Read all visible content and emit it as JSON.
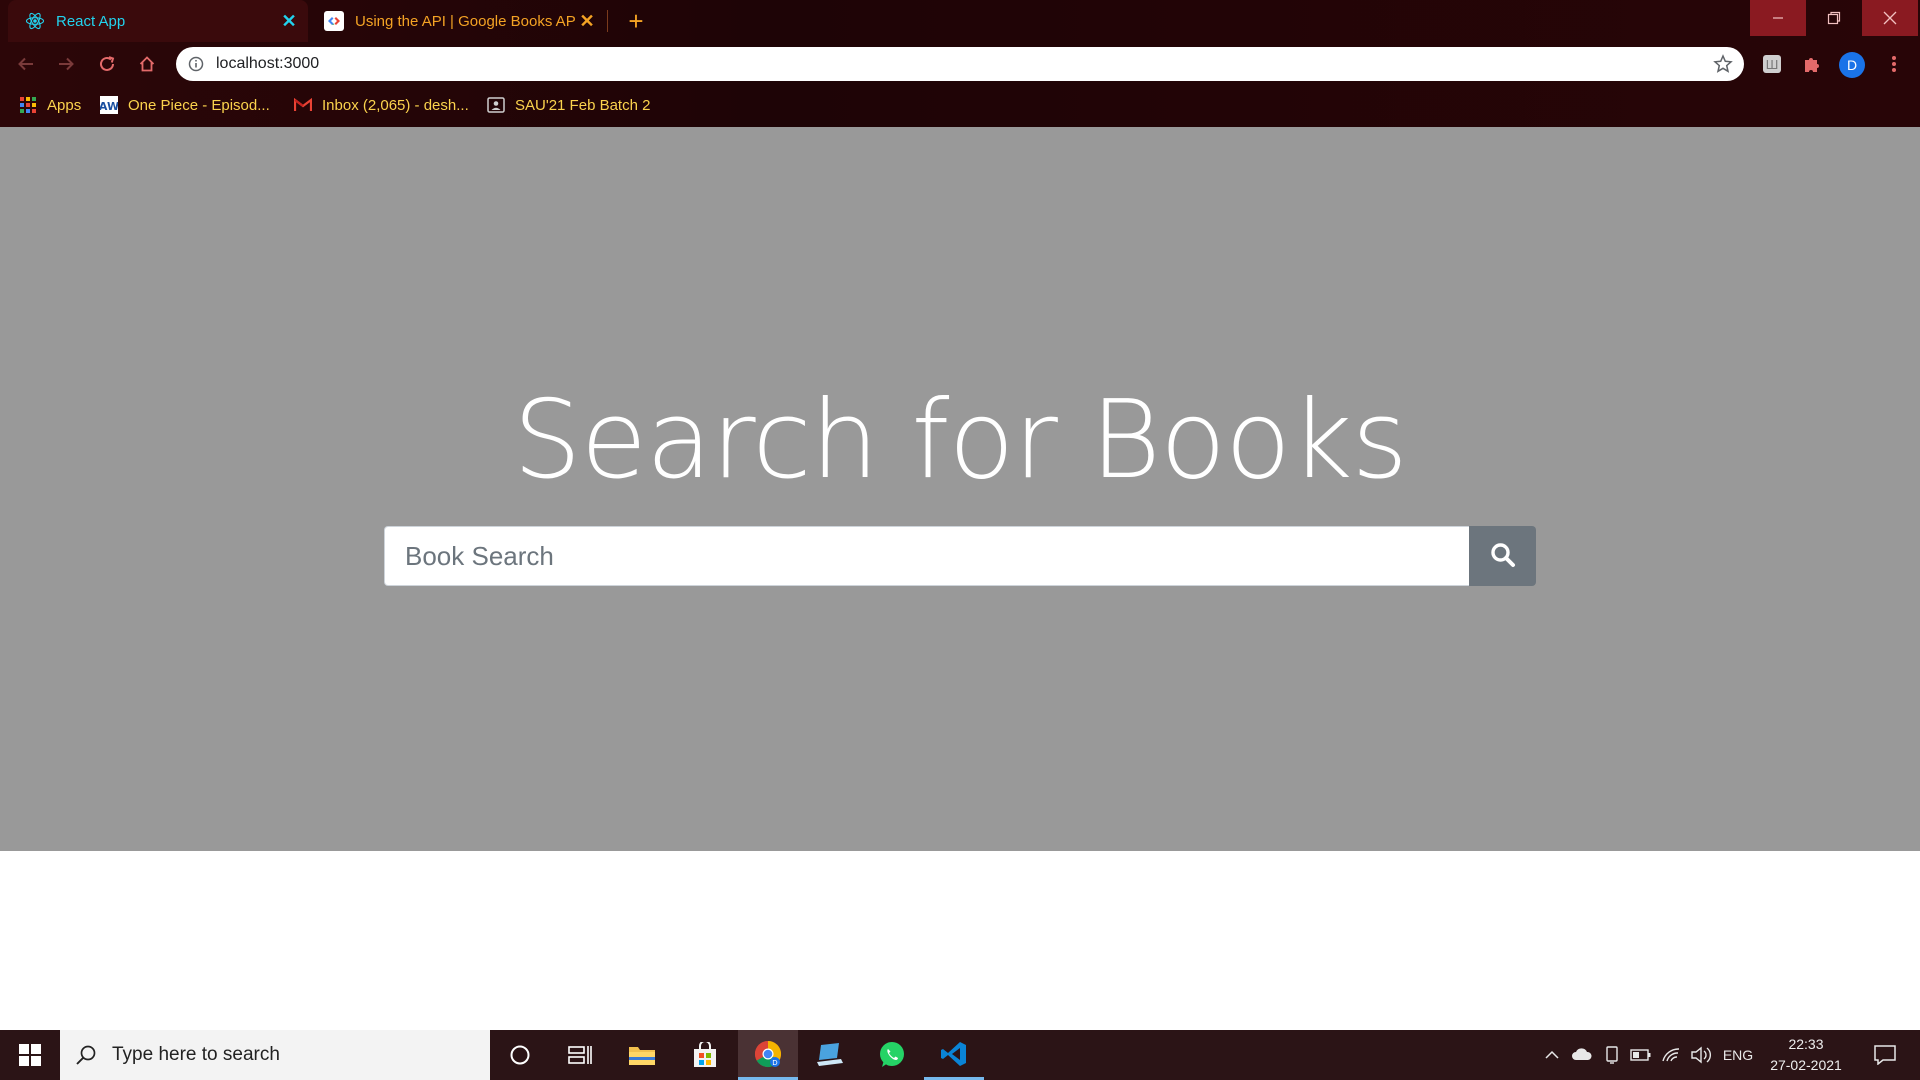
{
  "browser": {
    "tabs": [
      {
        "title": "React App",
        "favicon": "react-icon",
        "active": true
      },
      {
        "title": "Using the API  |  Google Books API",
        "favicon": "google-developers-icon",
        "active": false
      }
    ],
    "address": "localhost:3000",
    "profile_initial": "D",
    "bookmarks": [
      {
        "label": "Apps",
        "icon": "apps-grid-icon"
      },
      {
        "label": "One Piece - Episod...",
        "icon": "aw-icon"
      },
      {
        "label": "Inbox (2,065) - desh...",
        "icon": "gmail-icon"
      },
      {
        "label": "SAU'21 Feb Batch 2",
        "icon": "contact-card-icon"
      }
    ]
  },
  "page": {
    "title": "Search for Books",
    "search_placeholder": "Book Search"
  },
  "taskbar": {
    "search_placeholder": "Type here to search",
    "apps": [
      "cortana-icon",
      "task-view-icon",
      "file-explorer-icon",
      "microsoft-store-icon",
      "chrome-icon",
      "laptop-app-icon",
      "whatsapp-icon",
      "vscode-icon"
    ],
    "language": "ENG",
    "time": "22:33",
    "date": "27-02-2021"
  },
  "colors": {
    "hero_bg": "#999999",
    "search_button": "#6c757d",
    "active_tab_text": "#22d3ee",
    "inactive_tab_text": "#f4a324",
    "bookmark_text": "#fbd34d"
  }
}
